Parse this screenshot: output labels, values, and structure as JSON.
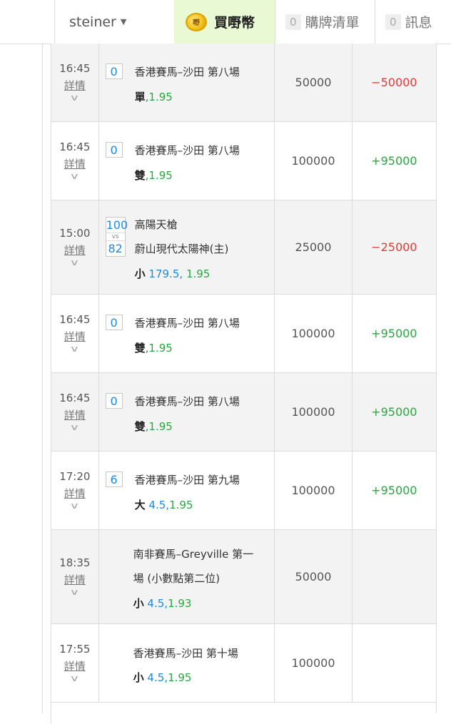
{
  "header": {
    "username": "steiner",
    "coin_label": "買嘢幣",
    "coin_icon": "coin-icon",
    "cart_count": "0",
    "cart_label": "購牌清單",
    "msg_count": "0",
    "msg_label": "訊息"
  },
  "rows": [
    {
      "time": "16:45",
      "detail": "詳情",
      "num": "0",
      "event": "香港賽馬–沙田 第八場",
      "pick": "單",
      "line": "",
      "odds": "1.95",
      "amount": "50000",
      "result": "−50000",
      "result_type": "neg"
    },
    {
      "time": "16:45",
      "detail": "詳情",
      "num": "0",
      "event": "香港賽馬–沙田 第八場",
      "pick": "雙",
      "line": "",
      "odds": "1.95",
      "amount": "100000",
      "result": "+95000",
      "result_type": "pos"
    },
    {
      "time": "15:00",
      "detail": "詳情",
      "score_a": "100",
      "vs": "vs",
      "score_b": "82",
      "team_a": "高陽天槍",
      "team_b": "蔚山現代太陽神(主)",
      "pick": "小",
      "line": "179.5",
      "odds": "1.95",
      "amount": "25000",
      "result": "−25000",
      "result_type": "neg"
    },
    {
      "time": "16:45",
      "detail": "詳情",
      "num": "0",
      "event": "香港賽馬–沙田 第八場",
      "pick": "雙",
      "line": "",
      "odds": "1.95",
      "amount": "100000",
      "result": "+95000",
      "result_type": "pos"
    },
    {
      "time": "16:45",
      "detail": "詳情",
      "num": "0",
      "event": "香港賽馬–沙田 第八場",
      "pick": "雙",
      "line": "",
      "odds": "1.95",
      "amount": "100000",
      "result": "+95000",
      "result_type": "pos"
    },
    {
      "time": "17:20",
      "detail": "詳情",
      "num": "6",
      "event": "香港賽馬–沙田 第九場",
      "pick": "大",
      "line": "4.5",
      "odds": "1.95",
      "amount": "100000",
      "result": "+95000",
      "result_type": "pos"
    },
    {
      "time": "18:35",
      "detail": "詳情",
      "event": "南非賽馬–Greyville 第一",
      "event2": "場 (小數點第二位)",
      "pick": "小",
      "line": "4.5",
      "odds": "1.93",
      "amount": "50000",
      "result": "",
      "result_type": ""
    },
    {
      "time": "17:55",
      "detail": "詳情",
      "event": "香港賽馬–沙田 第十場",
      "pick": "小",
      "line": "4.5",
      "odds": "1.95",
      "amount": "100000",
      "result": "",
      "result_type": ""
    }
  ],
  "colors": {
    "negative": "#e53935",
    "positive": "#2ba640",
    "accent": "#1e88e5",
    "coin_bg": "#e9f9d4"
  },
  "icons": {
    "dropdown": "caret-down-icon",
    "expand": "chevron-down-icon"
  }
}
